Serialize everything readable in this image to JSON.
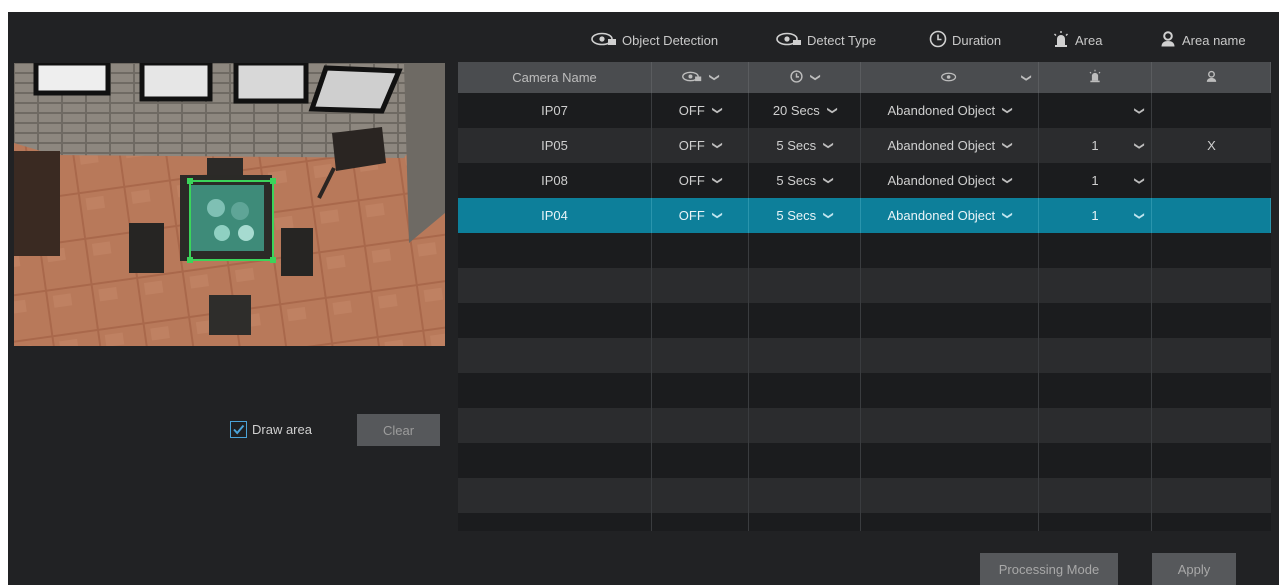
{
  "legend": {
    "object_detection": "Object Detection",
    "detect_type": "Detect Type",
    "duration": "Duration",
    "area": "Area",
    "area_name": "Area name"
  },
  "icons": {
    "object_detection": "object-detection-icon",
    "duration": "clock-icon",
    "area": "alarm-area-icon",
    "area_name": "person-icon"
  },
  "draw_area": {
    "label": "Draw area",
    "checked": true
  },
  "clear_button": "Clear",
  "table": {
    "header": {
      "camera_name": "Camera Name"
    },
    "rows": [
      {
        "camera": "IP07",
        "object_detection": "OFF",
        "duration": "20 Secs",
        "detect_type": "Abandoned Object",
        "area": "",
        "area_name": ""
      },
      {
        "camera": "IP05",
        "object_detection": "OFF",
        "duration": "5 Secs",
        "detect_type": "Abandoned Object",
        "area": "1",
        "area_name": "X"
      },
      {
        "camera": "IP08",
        "object_detection": "OFF",
        "duration": "5 Secs",
        "detect_type": "Abandoned Object",
        "area": "1",
        "area_name": ""
      },
      {
        "camera": "IP04",
        "object_detection": "OFF",
        "duration": "5 Secs",
        "detect_type": "Abandoned Object",
        "area": "1",
        "area_name": ""
      }
    ],
    "selected_row": 3
  },
  "buttons": {
    "processing_mode": "Processing Mode",
    "apply": "Apply"
  },
  "colors": {
    "background": "#212224",
    "header": "#4a4c4f",
    "selected_row": "#0d7f9a",
    "accent": "#4aa3d8",
    "detection_box": "#3bd45a"
  }
}
